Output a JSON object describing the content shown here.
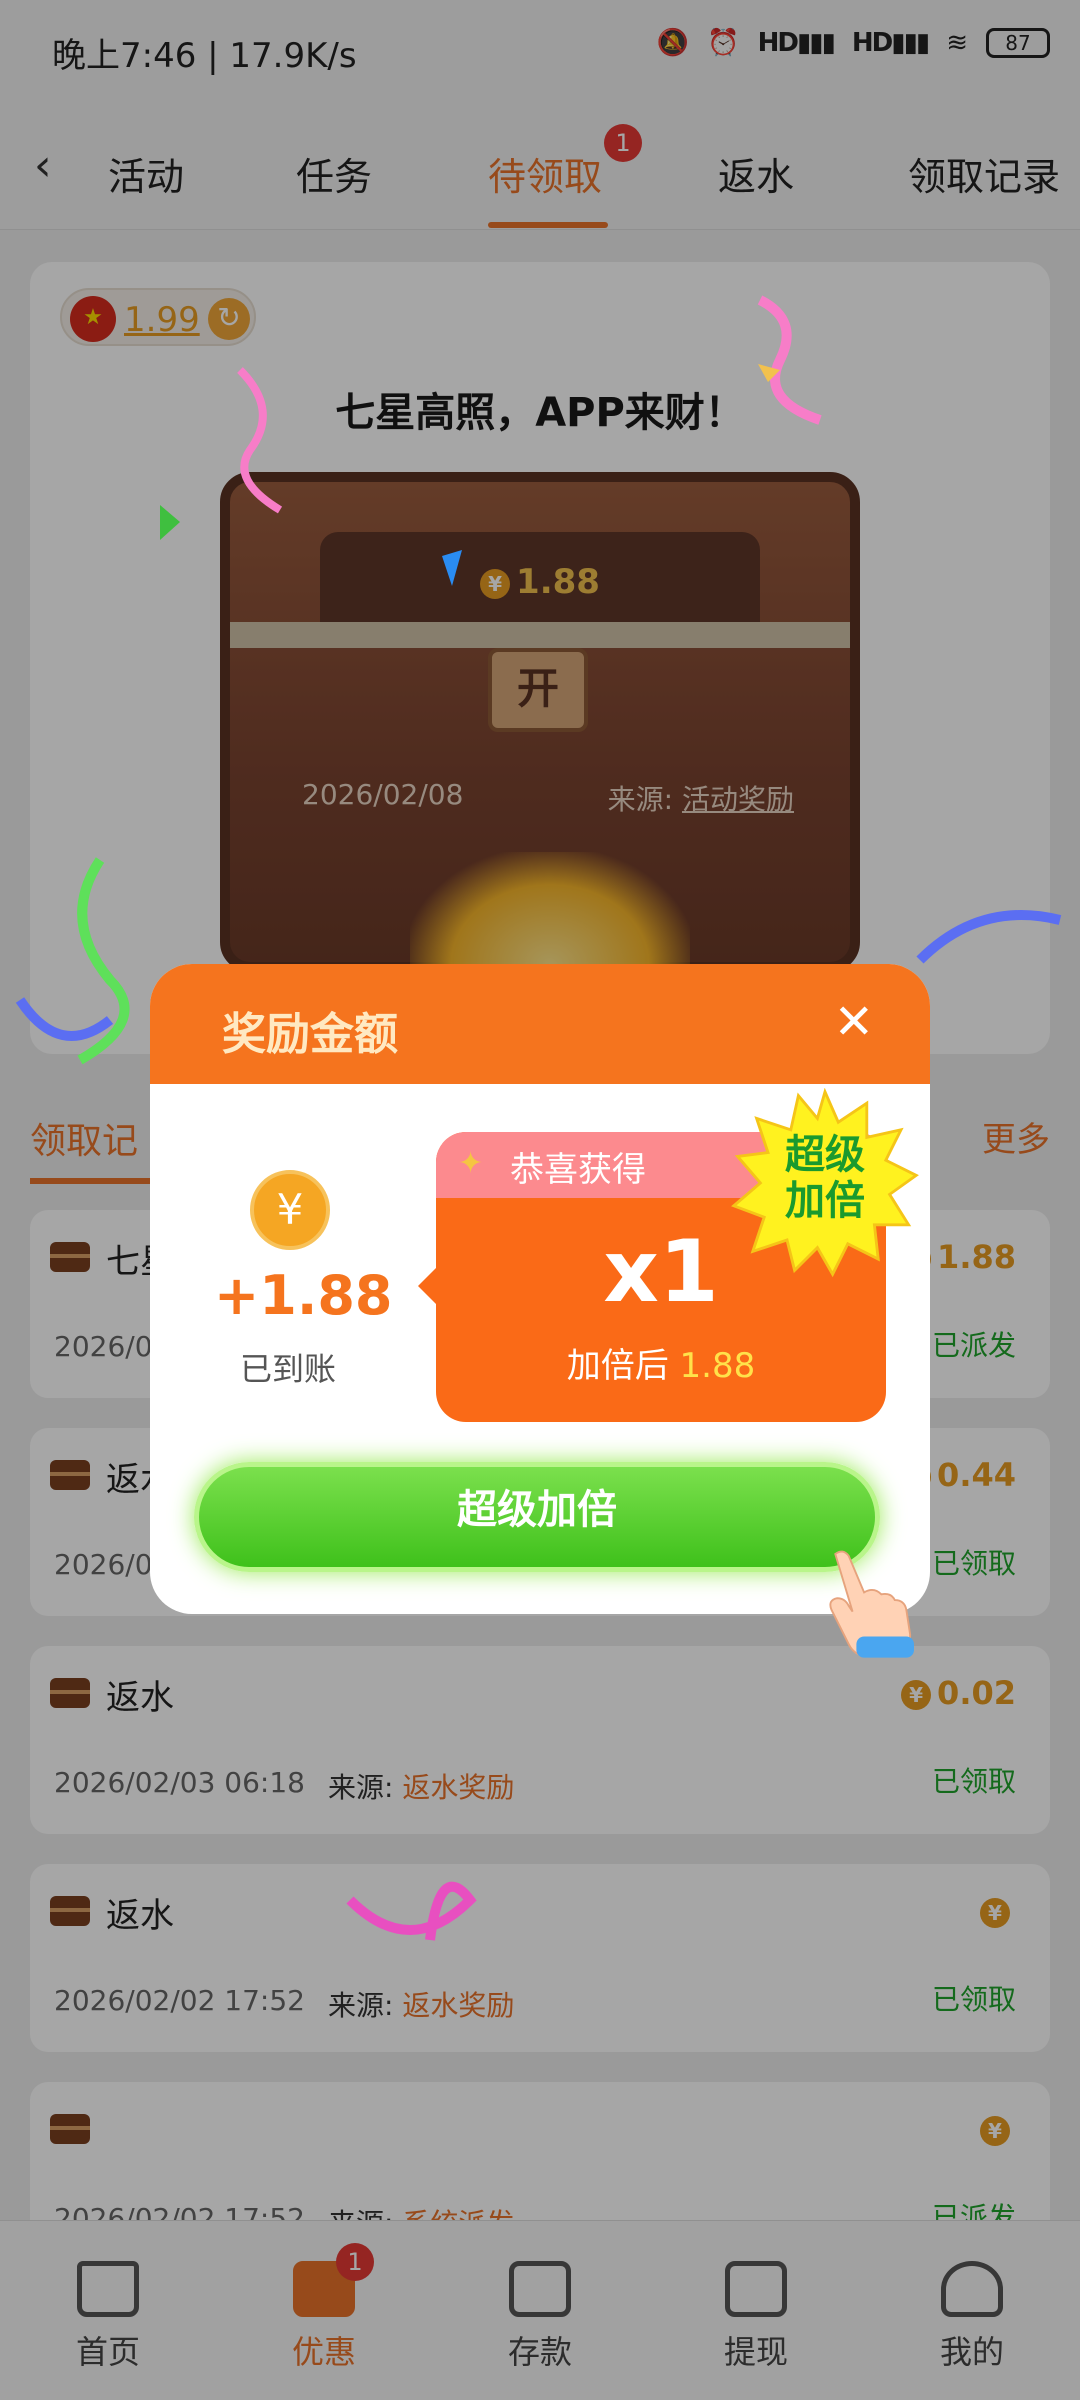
{
  "status_bar": {
    "time": "晚上7:46 | 17.9K/s",
    "signal1": "HD",
    "signal2": "HD",
    "battery": "87"
  },
  "tabs": {
    "items": [
      {
        "label": "活动"
      },
      {
        "label": "任务"
      },
      {
        "label": "待领取",
        "badge": "1"
      },
      {
        "label": "返水"
      },
      {
        "label": "领取记录"
      }
    ],
    "active_index": 2
  },
  "card": {
    "balance": "1.99",
    "title": "七星高照，APP来财！",
    "chest_amount": "1.88",
    "chest_lock": "开",
    "date": "2026/02/08",
    "source_label": "来源:",
    "source_value": "活动奖励"
  },
  "records_header": {
    "left": "领取记",
    "right": "更多"
  },
  "records": [
    {
      "title": "七星",
      "amount": "1.88",
      "date": "2026/0",
      "status": "已派发"
    },
    {
      "title": "返水",
      "amount": "0.44",
      "date": "2026/0",
      "status": "已领取"
    },
    {
      "title": "返水",
      "amount": "0.02",
      "date": "2026/02/03 06:18",
      "source_label": "来源:",
      "source_value": "返水奖励",
      "status": "已领取"
    },
    {
      "title": "返水",
      "amount": "",
      "date": "2026/02/02 17:52",
      "source_label": "来源:",
      "source_value": "返水奖励",
      "status": "已领取"
    },
    {
      "title": "",
      "amount": "",
      "date": "2026/02/02 17:52",
      "source_label": "来源:",
      "source_value": "系统派发",
      "status": "已派发"
    }
  ],
  "bottom_nav": {
    "items": [
      {
        "label": "首页",
        "icon": "home-icon"
      },
      {
        "label": "优惠",
        "icon": "gift-icon",
        "badge": "1"
      },
      {
        "label": "存款",
        "icon": "wallet-icon"
      },
      {
        "label": "提现",
        "icon": "withdraw-icon"
      },
      {
        "label": "我的",
        "icon": "person-icon"
      }
    ],
    "active_index": 1
  },
  "modal": {
    "title": "奖励金额",
    "close": "✕",
    "coin_symbol": "¥",
    "gain_amount": "+1.88",
    "gain_label": "已到账",
    "congrats": "恭喜获得",
    "multiplier": "x1",
    "after_label": "加倍后",
    "after_value": "1.88",
    "burst_text": "超级\n加倍",
    "cta": "超级加倍"
  },
  "colors": {
    "accent": "#e8722a",
    "modal_header": "#f5741e",
    "cta_green": "#3fc11b",
    "success": "#1fa32c",
    "gold": "#e69b22"
  }
}
